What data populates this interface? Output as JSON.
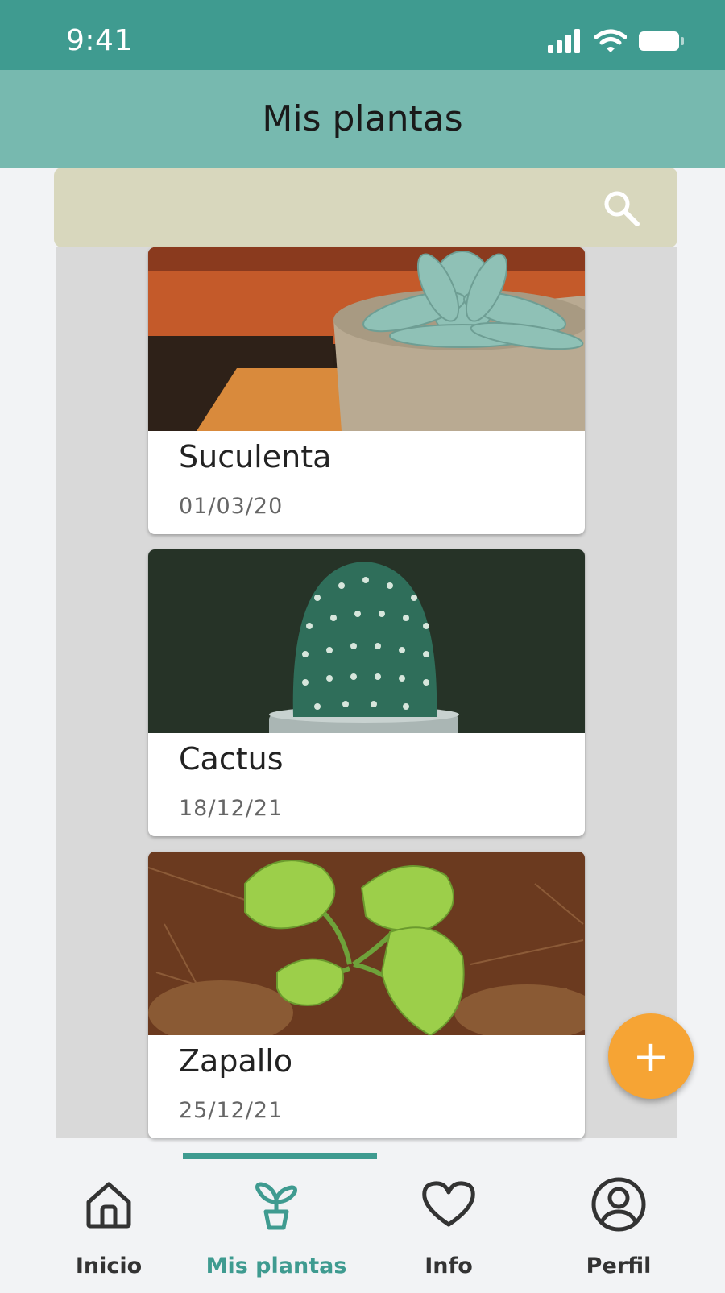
{
  "status_bar": {
    "time": "9:41"
  },
  "header": {
    "title": "Mis plantas"
  },
  "search": {
    "placeholder": ""
  },
  "plants": [
    {
      "name": "Suculenta",
      "date": "01/03/20"
    },
    {
      "name": "Cactus",
      "date": "18/12/21"
    },
    {
      "name": "Zapallo",
      "date": "25/12/21"
    }
  ],
  "fab": {
    "label": "+"
  },
  "nav": {
    "items": [
      {
        "label": "Inicio",
        "icon": "home-icon"
      },
      {
        "label": "Mis plantas",
        "icon": "plant-icon"
      },
      {
        "label": "Info",
        "icon": "heart-icon"
      },
      {
        "label": "Perfil",
        "icon": "profile-icon"
      }
    ],
    "active": "Mis plantas"
  },
  "colors": {
    "primary": "#3f9b90",
    "header": "#77b9af",
    "search": "#d8d7bd",
    "fab": "#f6a434"
  }
}
